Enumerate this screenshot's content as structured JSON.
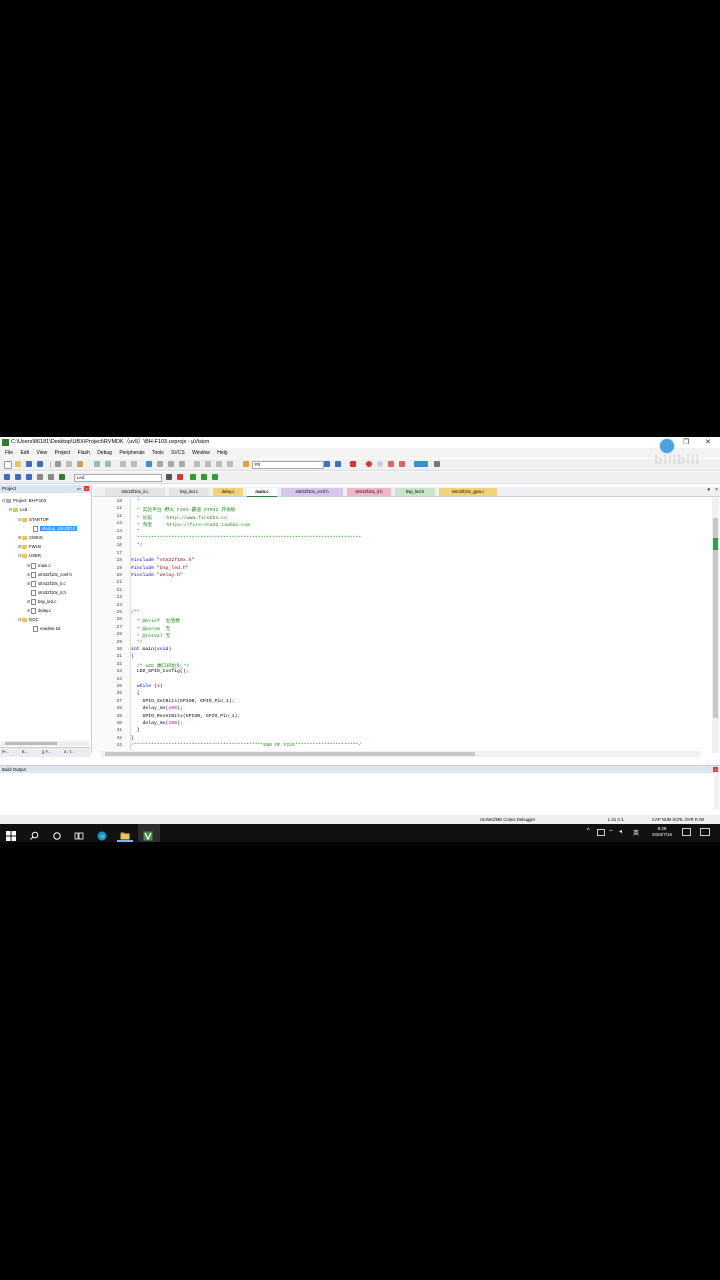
{
  "window": {
    "title": "C:\\Users\\86181\\Desktop\\UBX\\Project\\RVMDK（uv5）\\BH-F103.uvprojx - µVision",
    "minimize": "─",
    "maximize": "❐",
    "close": "✕"
  },
  "menu": [
    "File",
    "Edit",
    "View",
    "Project",
    "Flash",
    "Debug",
    "Peripherals",
    "Tools",
    "SVCS",
    "Window",
    "Help"
  ],
  "toolbar": {
    "target_combo": "P0",
    "target_name": "Led"
  },
  "project_panel": {
    "header": "Project",
    "root": "Project: BH-F103",
    "target": "Led",
    "groups": [
      {
        "name": "STARTUP",
        "files": [
          "startup_stm32f10x_hd.s"
        ]
      },
      {
        "name": "CMSIS",
        "files": []
      },
      {
        "name": "FWLB",
        "files": []
      },
      {
        "name": "USER",
        "files": [
          "main.c",
          "stm32f10x_conf.h",
          "stm32f10x_it.c",
          "stm32f10x_it.h",
          "bsp_led.c",
          "delay.c"
        ]
      },
      {
        "name": "DOC",
        "files": [
          "readme.txt"
        ]
      }
    ],
    "selected_file_label": "startup_stm32f10",
    "bottom_tabs": [
      "Pr...",
      "B...",
      "{} F...",
      "0↓ T..."
    ]
  },
  "editor": {
    "tabs": [
      {
        "label": "stm32f10x_it.c",
        "color": "#e4e4e4"
      },
      {
        "label": "bsp_led.c",
        "color": "#e4e4e4"
      },
      {
        "label": "delay.c",
        "color": "#f3d37a"
      },
      {
        "label": "main.c",
        "color": "#ffffff"
      },
      {
        "label": "stm32f10x_conf.h",
        "color": "#d9c6ef"
      },
      {
        "label": "stm32f10x_it.h",
        "color": "#f2b6c6"
      },
      {
        "label": "bsp_led.h",
        "color": "#c6e6c6"
      },
      {
        "label": "stm32f10x_gpio.c",
        "color": "#f3d37a"
      }
    ],
    "line_numbers": [
      "10",
      "11",
      "12",
      "13",
      "14",
      "15",
      "16",
      "17",
      "18",
      "19",
      "20",
      "21",
      "22",
      "23",
      "24",
      "25",
      "26",
      "27",
      "28",
      "29",
      "30",
      "31",
      "32",
      "33",
      "34",
      "35",
      "36",
      "37",
      "38",
      "39",
      "40",
      "41",
      "42",
      "43"
    ],
    "lines": [
      [
        {
          "t": "  *",
          "c": "cm"
        }
      ],
      [
        {
          "t": "  * 实验平台:野火 F103-霸道 STM32 开发板",
          "c": "cm"
        }
      ],
      [
        {
          "t": "  * 论坛    :http://www.firebbs.cn",
          "c": "cm"
        }
      ],
      [
        {
          "t": "  * 淘宝    :https://fire-stm32.taobao.com",
          "c": "cm"
        }
      ],
      [
        {
          "t": "  *",
          "c": "cm"
        }
      ],
      [
        {
          "t": "  ******************************************************************************",
          "c": "cm"
        }
      ],
      [
        {
          "t": "  */",
          "c": "cm"
        }
      ],
      [
        {
          "t": "",
          "c": "pl"
        }
      ],
      [
        {
          "t": "#include ",
          "c": "kw"
        },
        {
          "t": "\"stm32f10x.h\"",
          "c": "st"
        }
      ],
      [
        {
          "t": "#include ",
          "c": "kw"
        },
        {
          "t": "\"bsp_led.h\"",
          "c": "st"
        }
      ],
      [
        {
          "t": "#include ",
          "c": "kw"
        },
        {
          "t": "\"delay.h\"",
          "c": "st"
        }
      ],
      [
        {
          "t": "",
          "c": "pl"
        }
      ],
      [
        {
          "t": "",
          "c": "pl"
        }
      ],
      [
        {
          "t": "",
          "c": "pl"
        }
      ],
      [
        {
          "t": "",
          "c": "pl"
        }
      ],
      [
        {
          "t": "/**",
          "c": "cm"
        }
      ],
      [
        {
          "t": "  * @brief  主函数",
          "c": "cm"
        }
      ],
      [
        {
          "t": "  * @param  无",
          "c": "cm"
        }
      ],
      [
        {
          "t": "  * @retval 无",
          "c": "cm"
        }
      ],
      [
        {
          "t": "  */",
          "c": "cm"
        }
      ],
      [
        {
          "t": "int ",
          "c": "kw"
        },
        {
          "t": "main(",
          "c": "pl"
        },
        {
          "t": "void",
          "c": "kw"
        },
        {
          "t": ")",
          "c": "pl"
        }
      ],
      [
        {
          "t": "{",
          "c": "pl"
        }
      ],
      [
        {
          "t": "  /* LED 端口初始化 */",
          "c": "cm"
        }
      ],
      [
        {
          "t": "  LED_GPIO_Config();",
          "c": "pl"
        }
      ],
      [
        {
          "t": "",
          "c": "pl"
        }
      ],
      [
        {
          "t": "  while ",
          "c": "kw"
        },
        {
          "t": "(",
          "c": "pl"
        },
        {
          "t": "1",
          "c": "nm"
        },
        {
          "t": ")",
          "c": "pl"
        }
      ],
      [
        {
          "t": "  {",
          "c": "pl"
        }
      ],
      [
        {
          "t": "    GPIO_SetBits(GPIOB, GPIO_Pin_1);",
          "c": "pl"
        }
      ],
      [
        {
          "t": "    delay_ms(",
          "c": "pl"
        },
        {
          "t": "100",
          "c": "nm"
        },
        {
          "t": ");",
          "c": "pl"
        }
      ],
      [
        {
          "t": "    GPIO_ResetBits(GPIOB, GPIO_Pin_1);",
          "c": "pl"
        }
      ],
      [
        {
          "t": "    delay_ms(",
          "c": "pl"
        },
        {
          "t": "100",
          "c": "nm"
        },
        {
          "t": ");",
          "c": "pl"
        }
      ],
      [
        {
          "t": "  }",
          "c": "pl"
        }
      ],
      [
        {
          "t": "}",
          "c": "pl"
        }
      ],
      [
        {
          "t": "/*********************************************END OF FILE**********************/",
          "c": "cm"
        }
      ]
    ]
  },
  "build_output": {
    "title": "Build Output"
  },
  "status": {
    "debugger": "ULINK2/ME Cortex Debugger",
    "position": "L:41 C:1",
    "indicators": "CAP  NUM  SCRL  OVR  R /W"
  },
  "taskbar": {
    "time": "8:28",
    "date": "2020/7/15",
    "ime": "英"
  },
  "watermark": "bilibili"
}
